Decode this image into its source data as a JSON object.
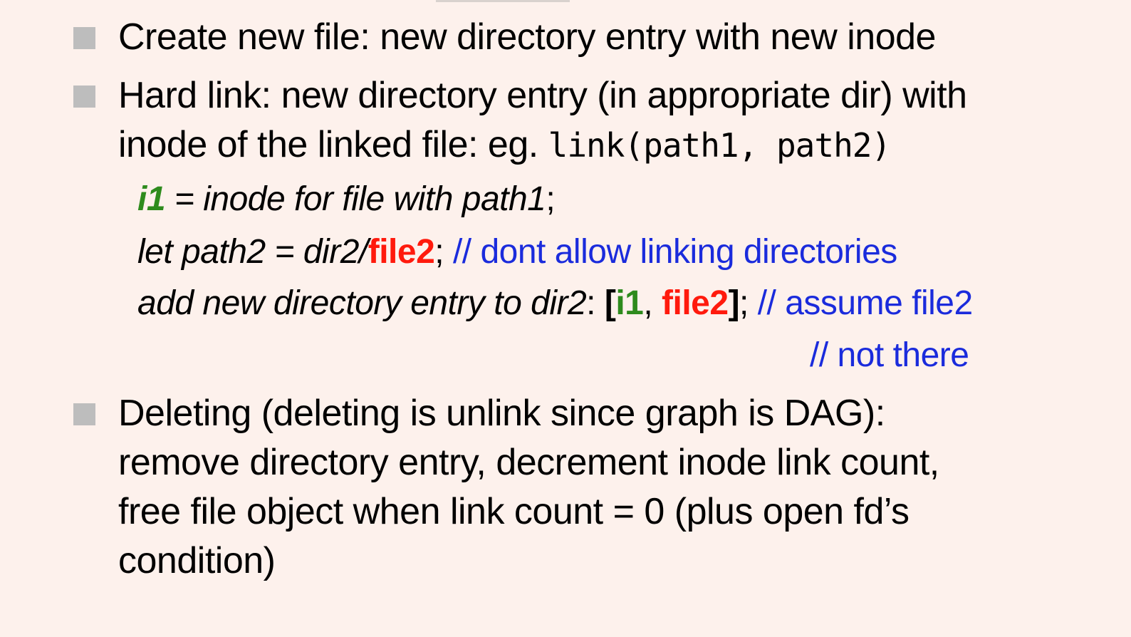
{
  "bullets": [
    {
      "text": "Create new file: new directory entry with new inode"
    },
    {
      "line1": "Hard link: new directory entry (in appropriate dir) with",
      "line2_prefix": "inode of the linked file: eg. ",
      "line2_code": "link(path1, path2)"
    },
    {
      "lines": [
        "Deleting (deleting is unlink since graph is DAG):",
        "remove directory entry, decrement inode link count,",
        "free file object when link count = 0 (plus open fd’s",
        "condition)"
      ]
    }
  ],
  "code": {
    "line1": {
      "var": "i1",
      "rest": " = inode for file with path1",
      "semi": ";"
    },
    "line2": {
      "prefix": "let path2 = dir2/",
      "file": "file2",
      "semi": "; ",
      "comment": "// dont allow linking directories"
    },
    "line3": {
      "prefix": "add new directory entry to dir2",
      "colon": ": ",
      "open": "[",
      "var": "i1",
      "comma": ", ",
      "file": "file2",
      "close": "]",
      "semi": "; ",
      "comment": "// assume file2"
    },
    "line4": {
      "comment": "// not there"
    }
  },
  "colors": {
    "background": "#fdf1ec",
    "bullet": "#bdbdbd",
    "variable_green": "#2e8b1d",
    "filename_red": "#ff1a0d",
    "comment_blue": "#1a2bdc"
  }
}
